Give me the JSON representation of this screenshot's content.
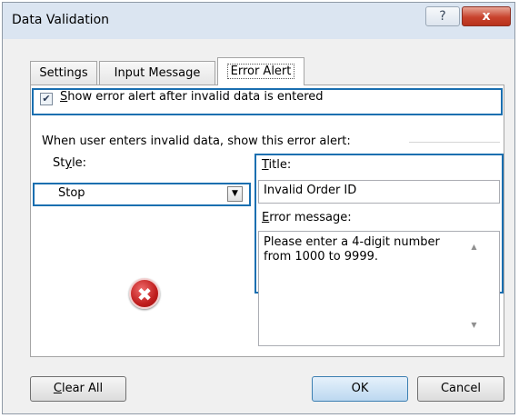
{
  "dialog": {
    "title": "Data Validation",
    "help_glyph": "?",
    "close_glyph": "x"
  },
  "tabs": [
    {
      "label": "Settings",
      "active": false
    },
    {
      "label": "Input Message",
      "active": false
    },
    {
      "label": "Error Alert",
      "active": true
    }
  ],
  "error_alert": {
    "show_alert_checked": true,
    "show_alert_label_underlined": "S",
    "show_alert_label_rest": "how error alert after invalid data is entered",
    "group_text": "When user enters invalid data, show this error alert:",
    "style_label_pre": "St",
    "style_label_underlined": "y",
    "style_label_post": "le:",
    "style_value": "Stop",
    "title_label_underlined": "T",
    "title_label_rest": "itle:",
    "title_value": "Invalid Order ID",
    "message_label_underlined": "E",
    "message_label_rest": "rror message:",
    "message_value": "Please enter a 4-digit number from 1000 to 9999.",
    "icon_glyph": "✖"
  },
  "buttons": {
    "clear_all_underlined": "C",
    "clear_all_rest": "lear All",
    "ok": "OK",
    "cancel": "Cancel"
  },
  "colors": {
    "highlight": "#1a6fb0",
    "titlebar": "#dbe5f1",
    "close_button": "#c8432d"
  }
}
